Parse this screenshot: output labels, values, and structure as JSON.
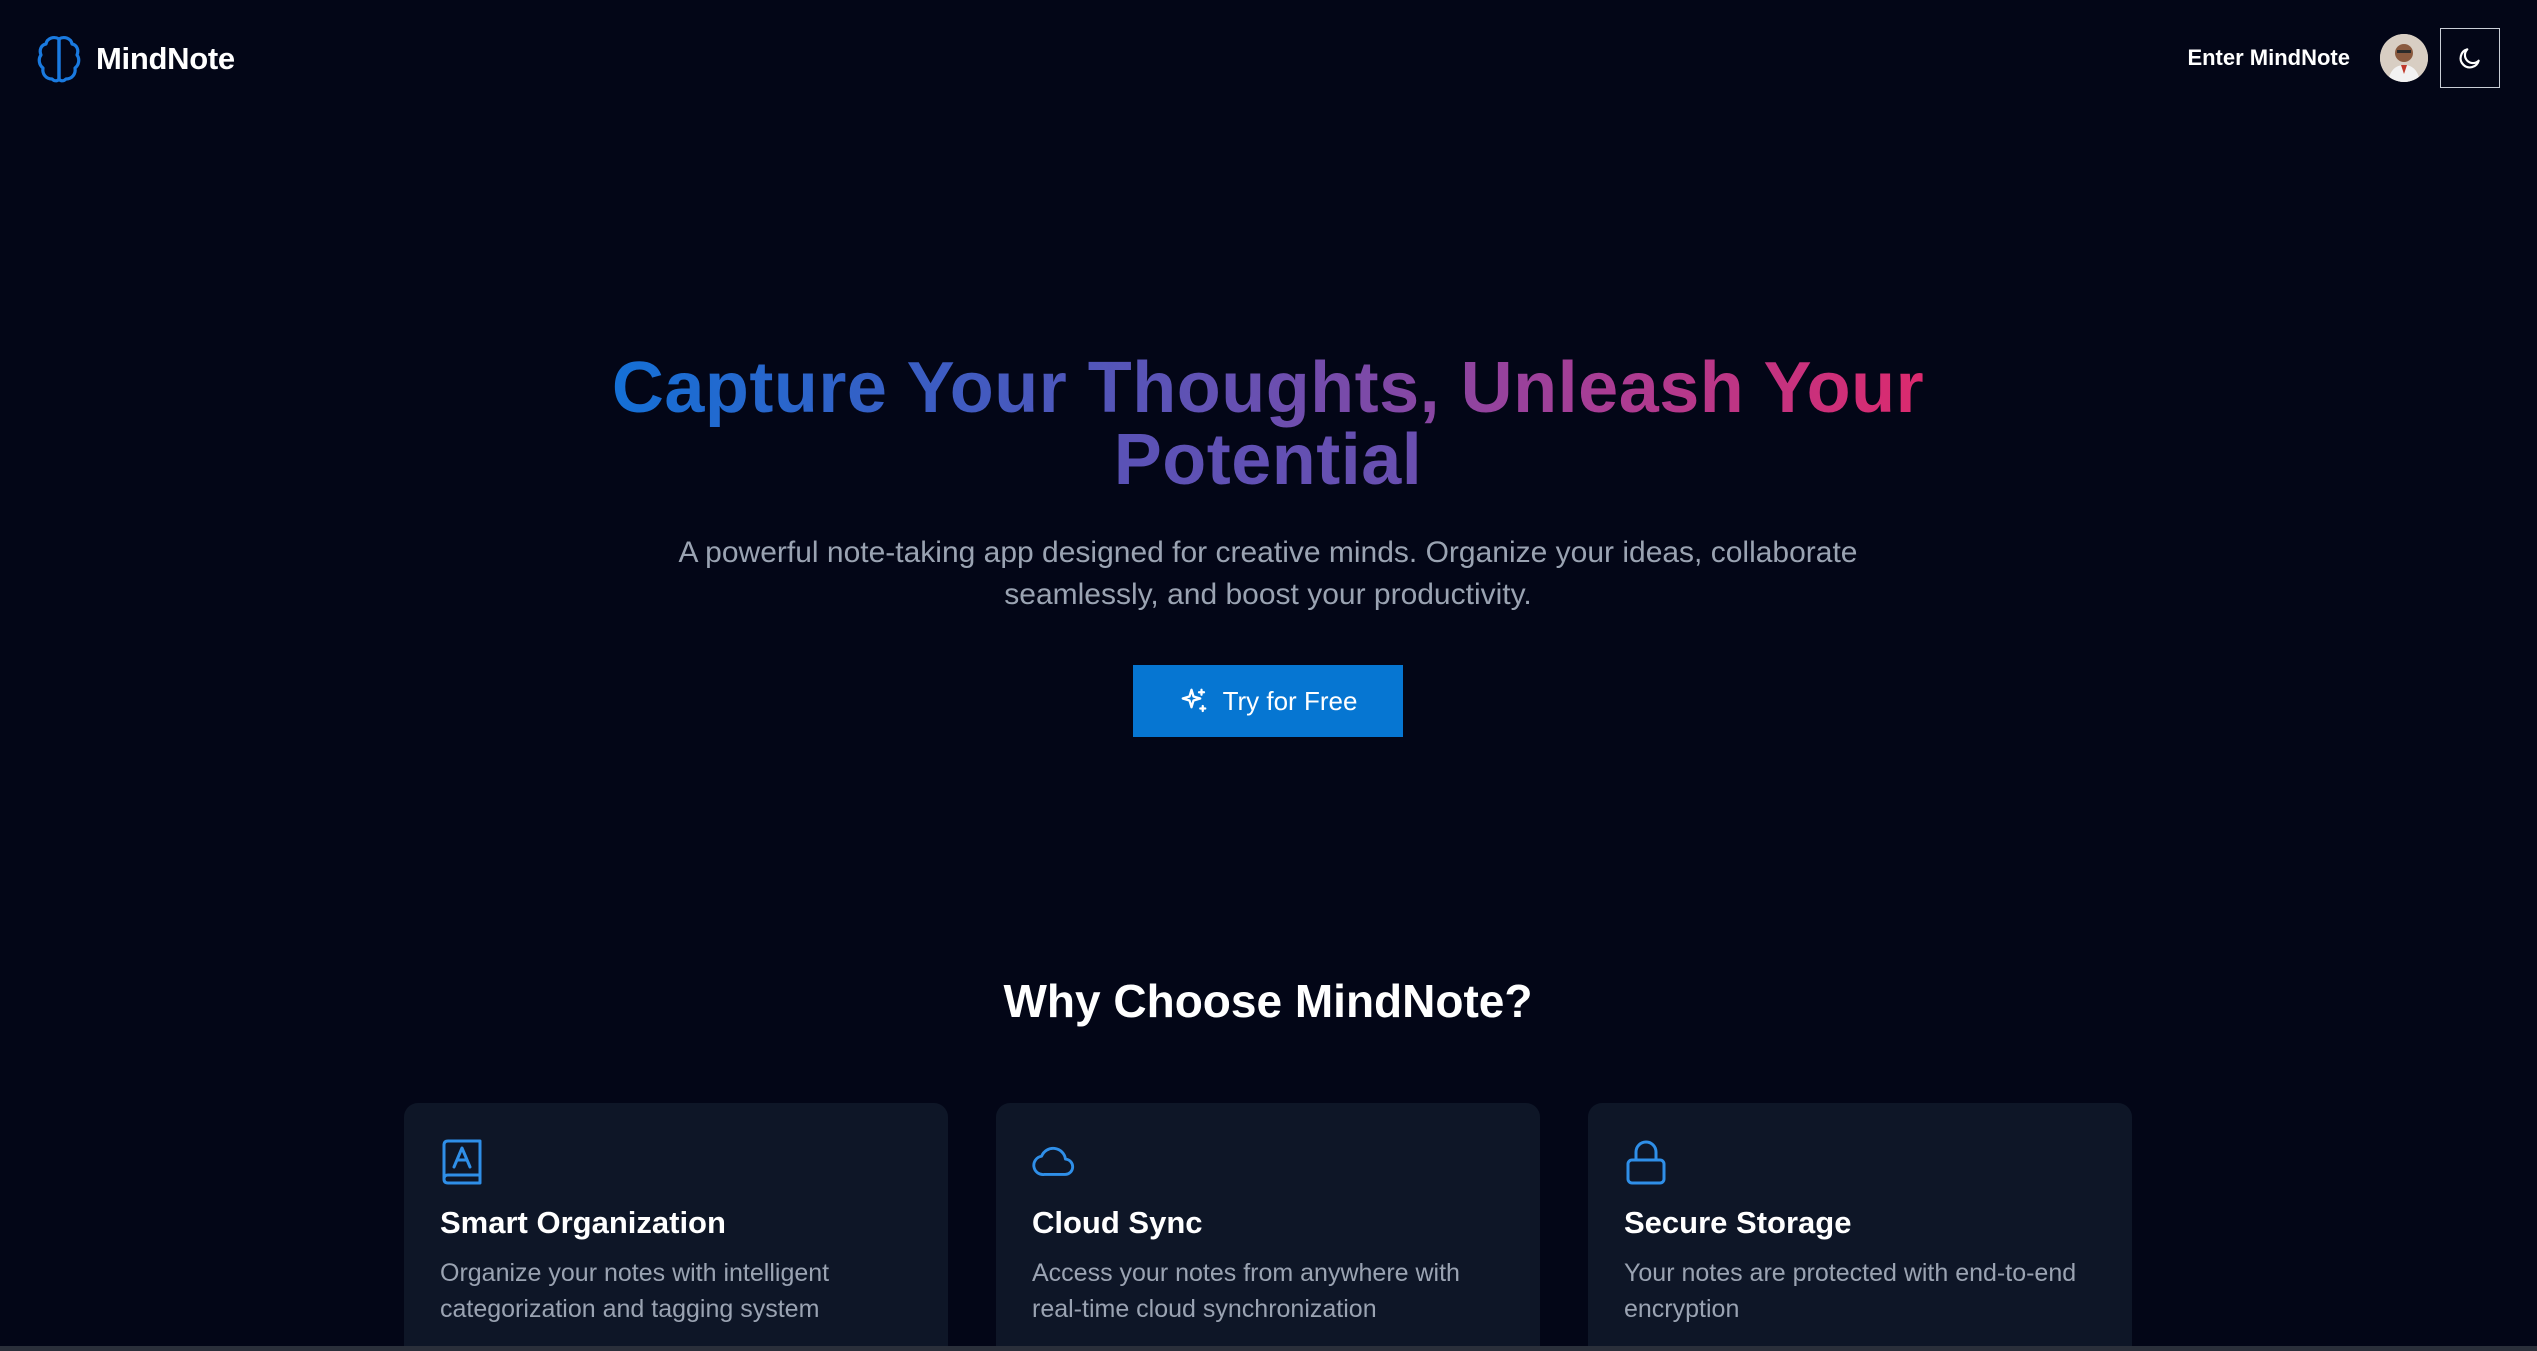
{
  "header": {
    "brand_name": "MindNote",
    "enter_link": "Enter MindNote",
    "avatar_icon": "user-avatar",
    "theme_icon": "moon-icon"
  },
  "hero": {
    "title_line1": "Capture Your Thoughts, Unleash Your",
    "title_line2": "Potential",
    "subtitle": "A powerful note-taking app designed for creative minds. Organize your ideas, collaborate seamlessly, and boost your productivity.",
    "cta_label": "Try for Free",
    "cta_icon": "sparkles-icon"
  },
  "features": {
    "title": "Why Choose MindNote?",
    "cards": [
      {
        "icon": "book-icon",
        "title": "Smart Organization",
        "description": "Organize your notes with intelligent categorization and tagging system"
      },
      {
        "icon": "cloud-icon",
        "title": "Cloud Sync",
        "description": "Access your notes from anywhere with real-time cloud synchronization"
      },
      {
        "icon": "lock-icon",
        "title": "Secure Storage",
        "description": "Your notes are protected with end-to-end encryption"
      }
    ]
  },
  "colors": {
    "background": "#030617",
    "accent": "#0676d2",
    "card": "#0e1627",
    "muted_text": "#9aa3b2",
    "gradient_start": "#1470d6",
    "gradient_end": "#dc2a6e"
  }
}
